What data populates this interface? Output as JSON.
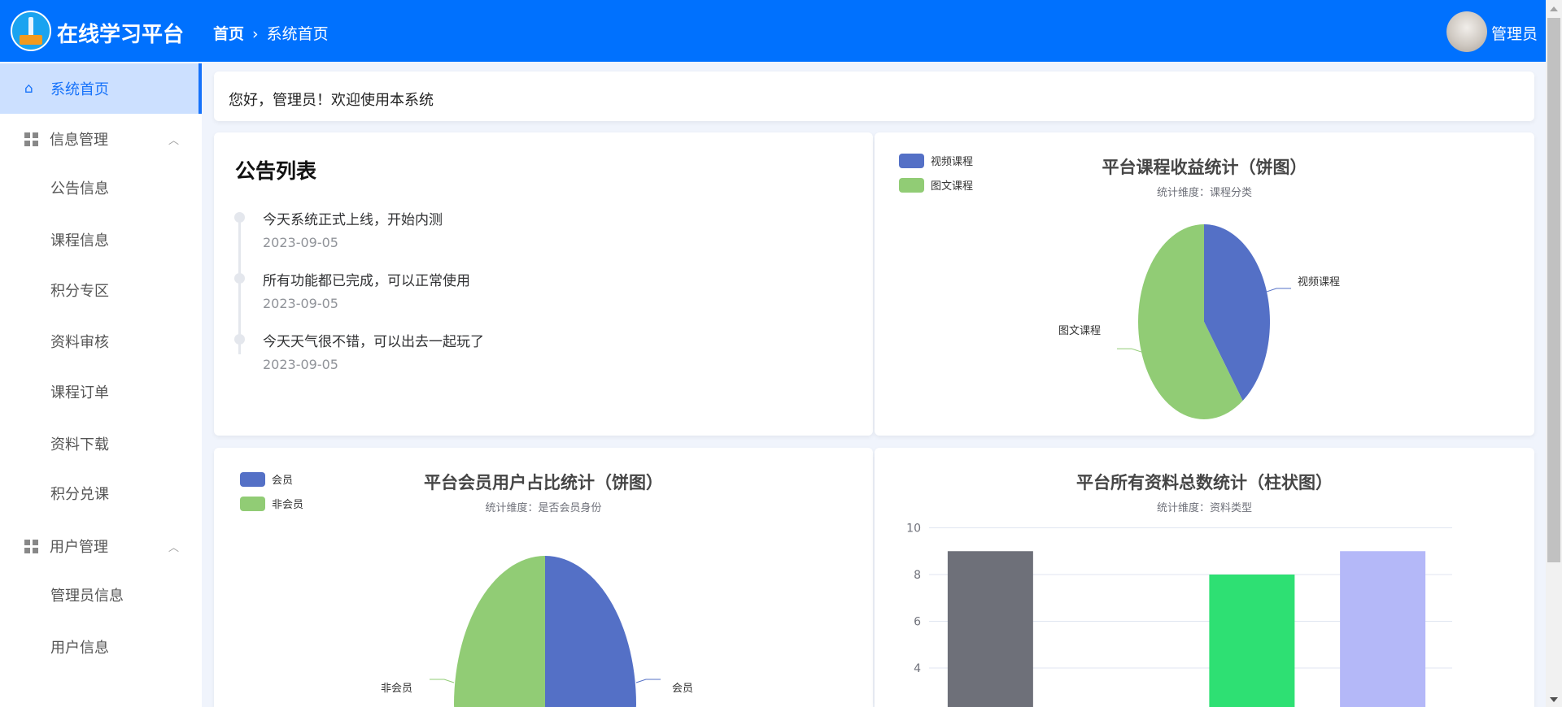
{
  "header": {
    "brand": "在线学习平台",
    "breadcrumb_home": "首页",
    "breadcrumb_sep": "›",
    "breadcrumb_current": "系统首页",
    "user_name": "管理员"
  },
  "sidebar": {
    "home": "系统首页",
    "info_group": "信息管理",
    "info_items": [
      "公告信息",
      "课程信息",
      "积分专区",
      "资料审核",
      "课程订单",
      "资料下载",
      "积分兑课"
    ],
    "user_group": "用户管理",
    "user_items": [
      "管理员信息",
      "用户信息"
    ]
  },
  "welcome": "您好，管理员！欢迎使用本系统",
  "notices": {
    "title": "公告列表",
    "items": [
      {
        "text": "今天系统正式上线，开始内测",
        "date": "2023-09-05"
      },
      {
        "text": "所有功能都已完成，可以正常使用",
        "date": "2023-09-05"
      },
      {
        "text": "今天天气很不错，可以出去一起玩了",
        "date": "2023-09-05"
      }
    ]
  },
  "chart_data": [
    {
      "type": "pie",
      "title": "平台课程收益统计（饼图）",
      "subtitle": "统计维度：课程分类",
      "legend": "top-left",
      "labels": [
        "视频课程",
        "图文课程"
      ],
      "values": [
        2,
        3
      ],
      "colors": [
        "#5470c6",
        "#91cc75"
      ]
    },
    {
      "type": "pie",
      "title": "平台会员用户占比统计（饼图）",
      "subtitle": "统计维度：是否会员身份",
      "legend": "top-left",
      "labels": [
        "会员",
        "非会员"
      ],
      "values": [
        1,
        1
      ],
      "colors": [
        "#5470c6",
        "#91cc75"
      ]
    },
    {
      "type": "bar",
      "title": "平台所有资料总数统计（柱状图）",
      "subtitle": "统计维度：资料类型",
      "values": [
        9,
        0,
        8,
        9
      ],
      "colors": [
        "#6e7079",
        "#5470c6",
        "#2ee073",
        "#b4b8f8"
      ],
      "yticks": [
        "4",
        "6",
        "8",
        "10"
      ],
      "ylim": [
        0,
        10
      ],
      "grid": true
    }
  ]
}
